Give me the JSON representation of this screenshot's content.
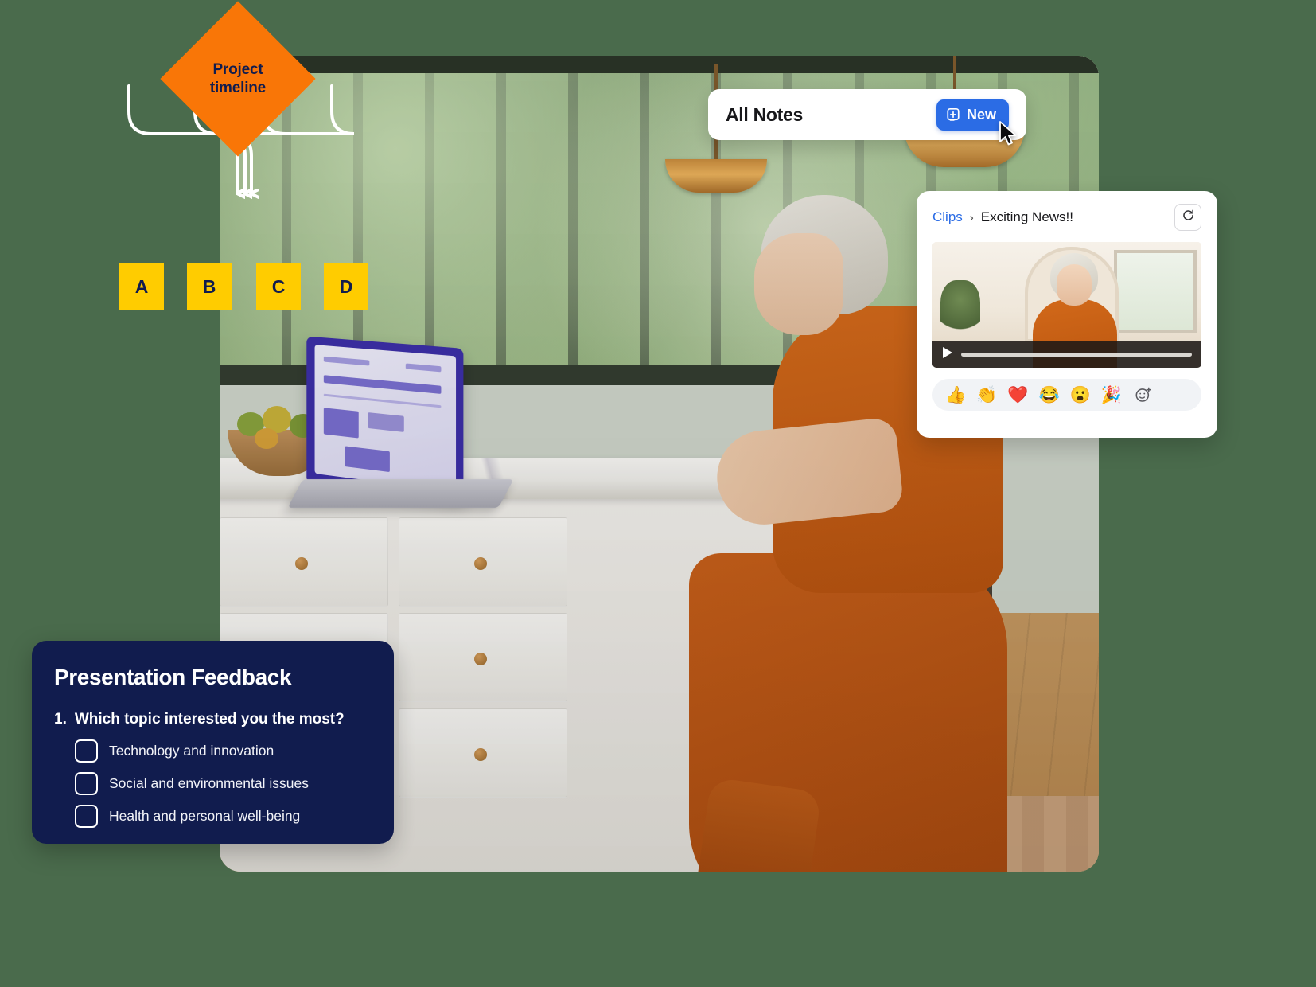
{
  "flow": {
    "diamond_label_line1": "Project",
    "diamond_label_line2": "timeline",
    "diamond_color": "#F97607",
    "node_color": "#FFCC00",
    "node_text_color": "#111C4E",
    "nodes": [
      {
        "label": "A"
      },
      {
        "label": "B"
      },
      {
        "label": "C"
      },
      {
        "label": "D"
      }
    ]
  },
  "notes_card": {
    "title": "All Notes",
    "new_button_label": "New",
    "new_button_icon": "new-note-icon",
    "accent_color": "#2B6CE5",
    "cursor_icon": "mouse-pointer-icon"
  },
  "clips_card": {
    "breadcrumb_root": "Clips",
    "breadcrumb_separator": "›",
    "breadcrumb_current": "Exciting News!!",
    "refresh_icon": "refresh-icon",
    "link_color": "#2B6CE5",
    "video": {
      "play_icon": "play-icon",
      "progress_percent": 0
    },
    "reactions": [
      {
        "name": "thumbs-up-emoji",
        "glyph": "👍"
      },
      {
        "name": "clapping-hands-emoji",
        "glyph": "👏"
      },
      {
        "name": "red-heart-emoji",
        "glyph": "❤️"
      },
      {
        "name": "joy-emoji",
        "glyph": "😂"
      },
      {
        "name": "open-mouth-emoji",
        "glyph": "😮"
      },
      {
        "name": "party-popper-emoji",
        "glyph": "🎉"
      }
    ],
    "add_reaction_icon": "add-reaction-icon"
  },
  "feedback_card": {
    "title": "Presentation Feedback",
    "question_number": "1.",
    "question_text": "Which topic interested you the most?",
    "background_color": "#111C4E",
    "options": [
      {
        "label": "Technology and innovation",
        "checked": false
      },
      {
        "label": "Social and environmental issues",
        "checked": false
      },
      {
        "label": "Health and personal well-being",
        "checked": false
      }
    ]
  }
}
